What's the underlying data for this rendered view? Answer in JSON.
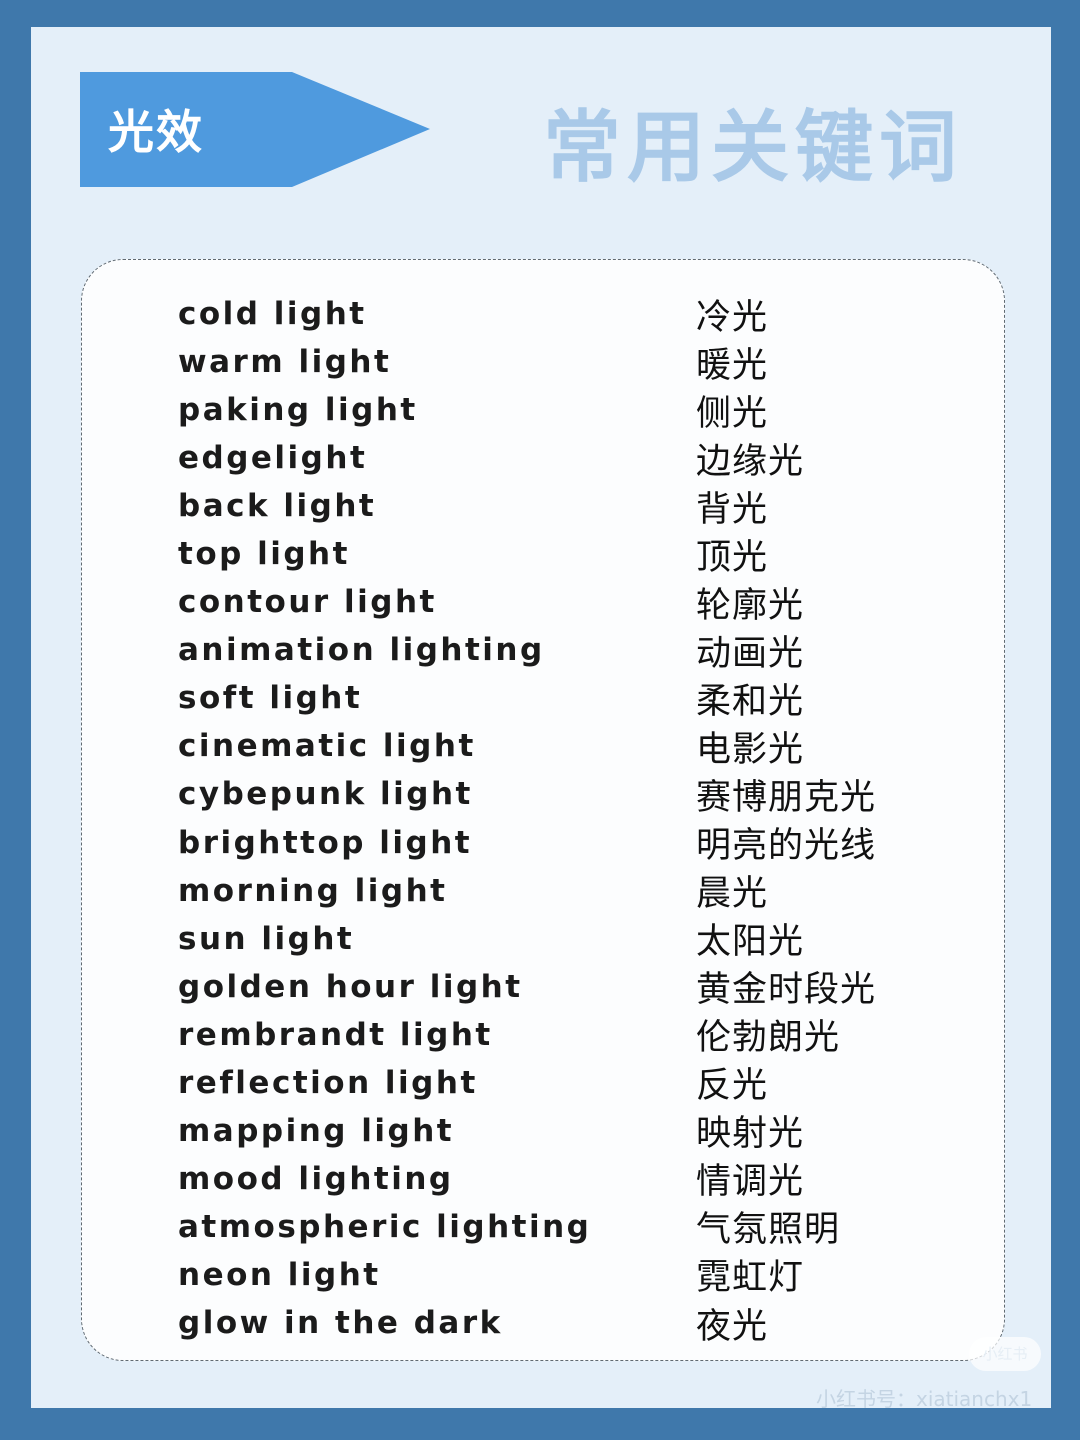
{
  "header": {
    "tag": "光效",
    "title": "常用关键词"
  },
  "colors": {
    "background": "#3f78ab",
    "page": "#e4eff9",
    "tag": "#4f9ade",
    "title": "#a9c9e8"
  },
  "terms": [
    {
      "en": "cold light",
      "zh": "冷光"
    },
    {
      "en": "warm light",
      "zh": "暖光"
    },
    {
      "en": "paking light",
      "zh": "侧光"
    },
    {
      "en": "edgelight",
      "zh": "边缘光"
    },
    {
      "en": "back light",
      "zh": "背光"
    },
    {
      "en": "top light",
      "zh": "顶光"
    },
    {
      "en": "contour light",
      "zh": "轮廓光"
    },
    {
      "en": "animation lighting",
      "zh": "动画光"
    },
    {
      "en": "soft light",
      "zh": "柔和光"
    },
    {
      "en": "cinematic light",
      "zh": "电影光"
    },
    {
      "en": "cybepunk light",
      "zh": "赛博朋克光"
    },
    {
      "en": "brighttop light",
      "zh": "明亮的光线"
    },
    {
      "en": "morning light",
      "zh": "晨光"
    },
    {
      "en": "sun light",
      "zh": "太阳光"
    },
    {
      "en": "golden hour light",
      "zh": "黄金时段光"
    },
    {
      "en": "rembrandt light",
      "zh": "伦勃朗光"
    },
    {
      "en": "reflection light",
      "zh": "反光"
    },
    {
      "en": "mapping light",
      "zh": "映射光"
    },
    {
      "en": "mood lighting",
      "zh": "情调光"
    },
    {
      "en": "atmospheric lighting",
      "zh": "气氛照明"
    },
    {
      "en": "neon light",
      "zh": "霓虹灯"
    },
    {
      "en": "glow in the dark",
      "zh": "夜光"
    }
  ],
  "watermark": {
    "badge": "小红书",
    "text": "小红书号：xiatianchx1"
  }
}
